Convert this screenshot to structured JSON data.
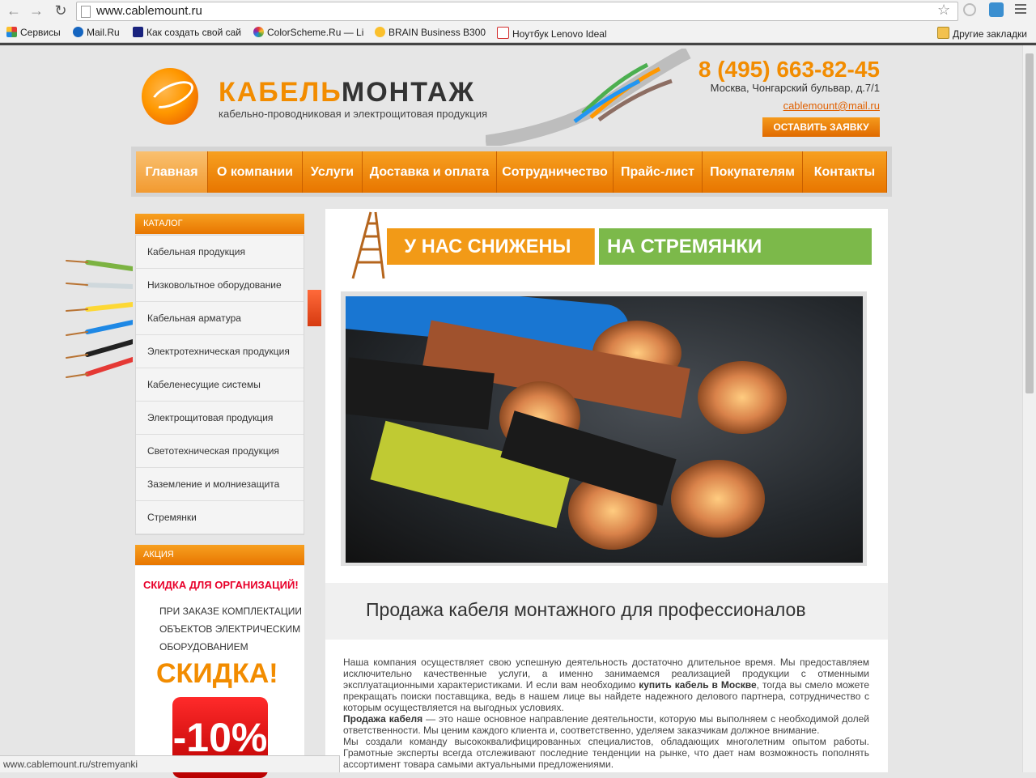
{
  "browser": {
    "url": "www.cablemount.ru",
    "bookmarks": [
      {
        "label": "Сервисы",
        "color": "#e53935"
      },
      {
        "label": "Mail.Ru",
        "color": "#1565c0"
      },
      {
        "label": "Как создать свой сай",
        "color": "#1a237e"
      },
      {
        "label": "ColorScheme.Ru — Li",
        "color": "#8e24aa"
      },
      {
        "label": "BRAIN Business B300",
        "color": "#fbc02d"
      },
      {
        "label": "Ноутбук Lenovo Ideal",
        "color": "#d32f2f"
      }
    ],
    "other_bookmarks": "Другие закладки",
    "status_url": "www.cablemount.ru/stremyanki"
  },
  "header": {
    "logo_part1": "КАБЕЛЬ",
    "logo_part2": "МОНТАЖ",
    "tagline": "кабельно-проводниковая и  электрощитовая продукция",
    "phone": "8 (495) 663-82-45",
    "address": "Москва, Чонгарский бульвар, д.7/1",
    "email": "cablemount@mail.ru",
    "request_button": "ОСТАВИТЬ ЗАЯВКУ"
  },
  "nav": [
    {
      "label": "Главная",
      "active": true,
      "width": 89
    },
    {
      "label": "О компании",
      "active": false,
      "width": 117
    },
    {
      "label": "Услуги",
      "active": false,
      "width": 74
    },
    {
      "label": "Доставка и оплата",
      "active": false,
      "width": 166
    },
    {
      "label": "Сотрудничество",
      "active": false,
      "width": 144
    },
    {
      "label": "Прайс-лист",
      "active": false,
      "width": 110
    },
    {
      "label": "Покупателям",
      "active": false,
      "width": 124
    },
    {
      "label": "Контакты",
      "active": false,
      "width": 104
    }
  ],
  "sidebar": {
    "catalog_title": "КАТАЛОГ",
    "catalog_items": [
      "Кабельная продукция",
      "Низковольтное оборудование",
      "Кабельная арматура",
      "Электротехническая продукция",
      "Кабеленесущие системы",
      "Электрощитовая продукция",
      "Светотехническая продукция",
      "Заземление и молниезащита",
      "Стремянки"
    ],
    "akcia_title": "АКЦИЯ",
    "akcia_headline": "СКИДКА ДЛЯ ОРГАНИЗАЦИЙ!",
    "akcia_line1": "ПРИ ЗАКАЗЕ КОМПЛЕКТАЦИИ",
    "akcia_line2": "ОБЪЕКТОВ ЭЛЕКТРИЧЕСКИМ",
    "akcia_line3": "ОБОРУДОВАНИЕМ",
    "skidka": "СКИДКА!",
    "percent": "-10%"
  },
  "main": {
    "banner_orange": "У НАС СНИЖЕНЫ ЦЕНЫ",
    "banner_green": "НА СТРЕМЯНКИ ДЕРЕВЯННЫЕ",
    "heading": "Продажа кабеля монтажного для профессионалов",
    "p1_a": "Наша компания осуществляет свою успешную деятельность достаточно длительное время. Мы предоставляем исключительно качественные услуги, а именно занимаемся реализацией продукции с отменными эксплуатационными характеристиками. И если вам необходимо ",
    "p1_bold": "купить кабель в Москве",
    "p1_b": ", тогда вы смело можете прекращать поиски поставщика, ведь в нашем лице вы найдете надежного делового партнера, сотрудничество с которым осуществляется на выгодных условиях.",
    "p2_bold": "Продажа кабеля",
    "p2": " — это наше основное направление деятельности, которую мы выполняем с необходимой долей ответственности. Мы ценим каждого клиента и, соответственно, уделяем заказчикам должное внимание.",
    "p3": "Мы создали команду высококвалифицированных специалистов, обладающих многолетним опытом работы. Грамотные эксперты всегда отслеживают последние тенденции на рынке, что дает нам возможность пополнять ассортимент товара самыми актуальными предложениями."
  }
}
